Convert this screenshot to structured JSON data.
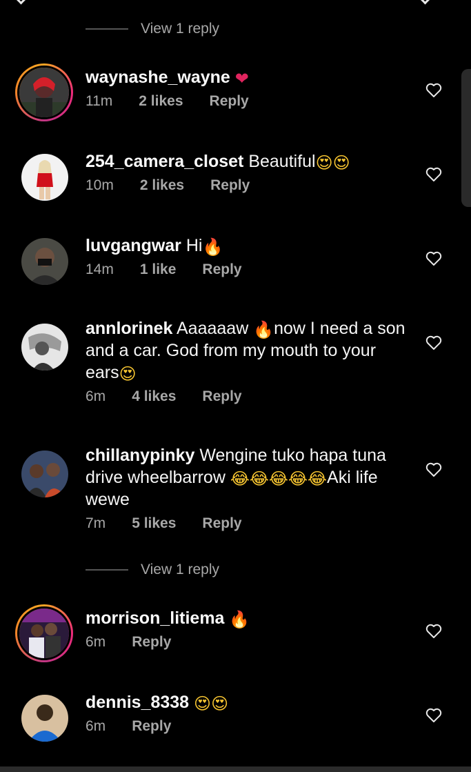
{
  "top_view_replies": "View 1 reply",
  "middle_view_replies": "View 1 reply",
  "comments": [
    {
      "username": "waynashe_wayne",
      "text": "",
      "emoji": "❤",
      "time": "11m",
      "likes": "2 likes",
      "reply": "Reply",
      "has_story_ring": true
    },
    {
      "username": "254_camera_closet",
      "text": "Beautiful",
      "emoji": "😍😍",
      "time": "10m",
      "likes": "2 likes",
      "reply": "Reply",
      "has_story_ring": false
    },
    {
      "username": "luvgangwar",
      "text": "Hi",
      "emoji": "🔥",
      "time": "14m",
      "likes": "1 like",
      "reply": "Reply",
      "has_story_ring": false
    },
    {
      "username": "annlorinek",
      "text_before": "Aaaaaaw",
      "emoji_mid": "🔥",
      "text": "now I need a son and a car. God from my mouth to your ears",
      "emoji": "😍",
      "time": "6m",
      "likes": "4 likes",
      "reply": "Reply",
      "has_story_ring": false
    },
    {
      "username": "chillanypinky",
      "text_before": "Wengine tuko hapa tuna drive wheelbarrow",
      "emoji_mid": "😂😂😂😂😂",
      "text": "Aki life wewe",
      "time": "7m",
      "likes": "5 likes",
      "reply": "Reply",
      "has_story_ring": false
    },
    {
      "username": "morrison_litiema",
      "text": "",
      "emoji": "🔥",
      "time": "6m",
      "likes": "",
      "reply": "Reply",
      "has_story_ring": true
    },
    {
      "username": "dennis_8338",
      "text": "",
      "emoji": "😍😍",
      "time": "6m",
      "likes": "",
      "reply": "Reply",
      "has_story_ring": false
    }
  ],
  "colors": {
    "background": "#000000",
    "text_primary": "#f5f5f5",
    "text_secondary": "#a8a8a8",
    "story_ring": "#ee2a7b"
  },
  "icons": {
    "like": "heart-outline-icon"
  }
}
